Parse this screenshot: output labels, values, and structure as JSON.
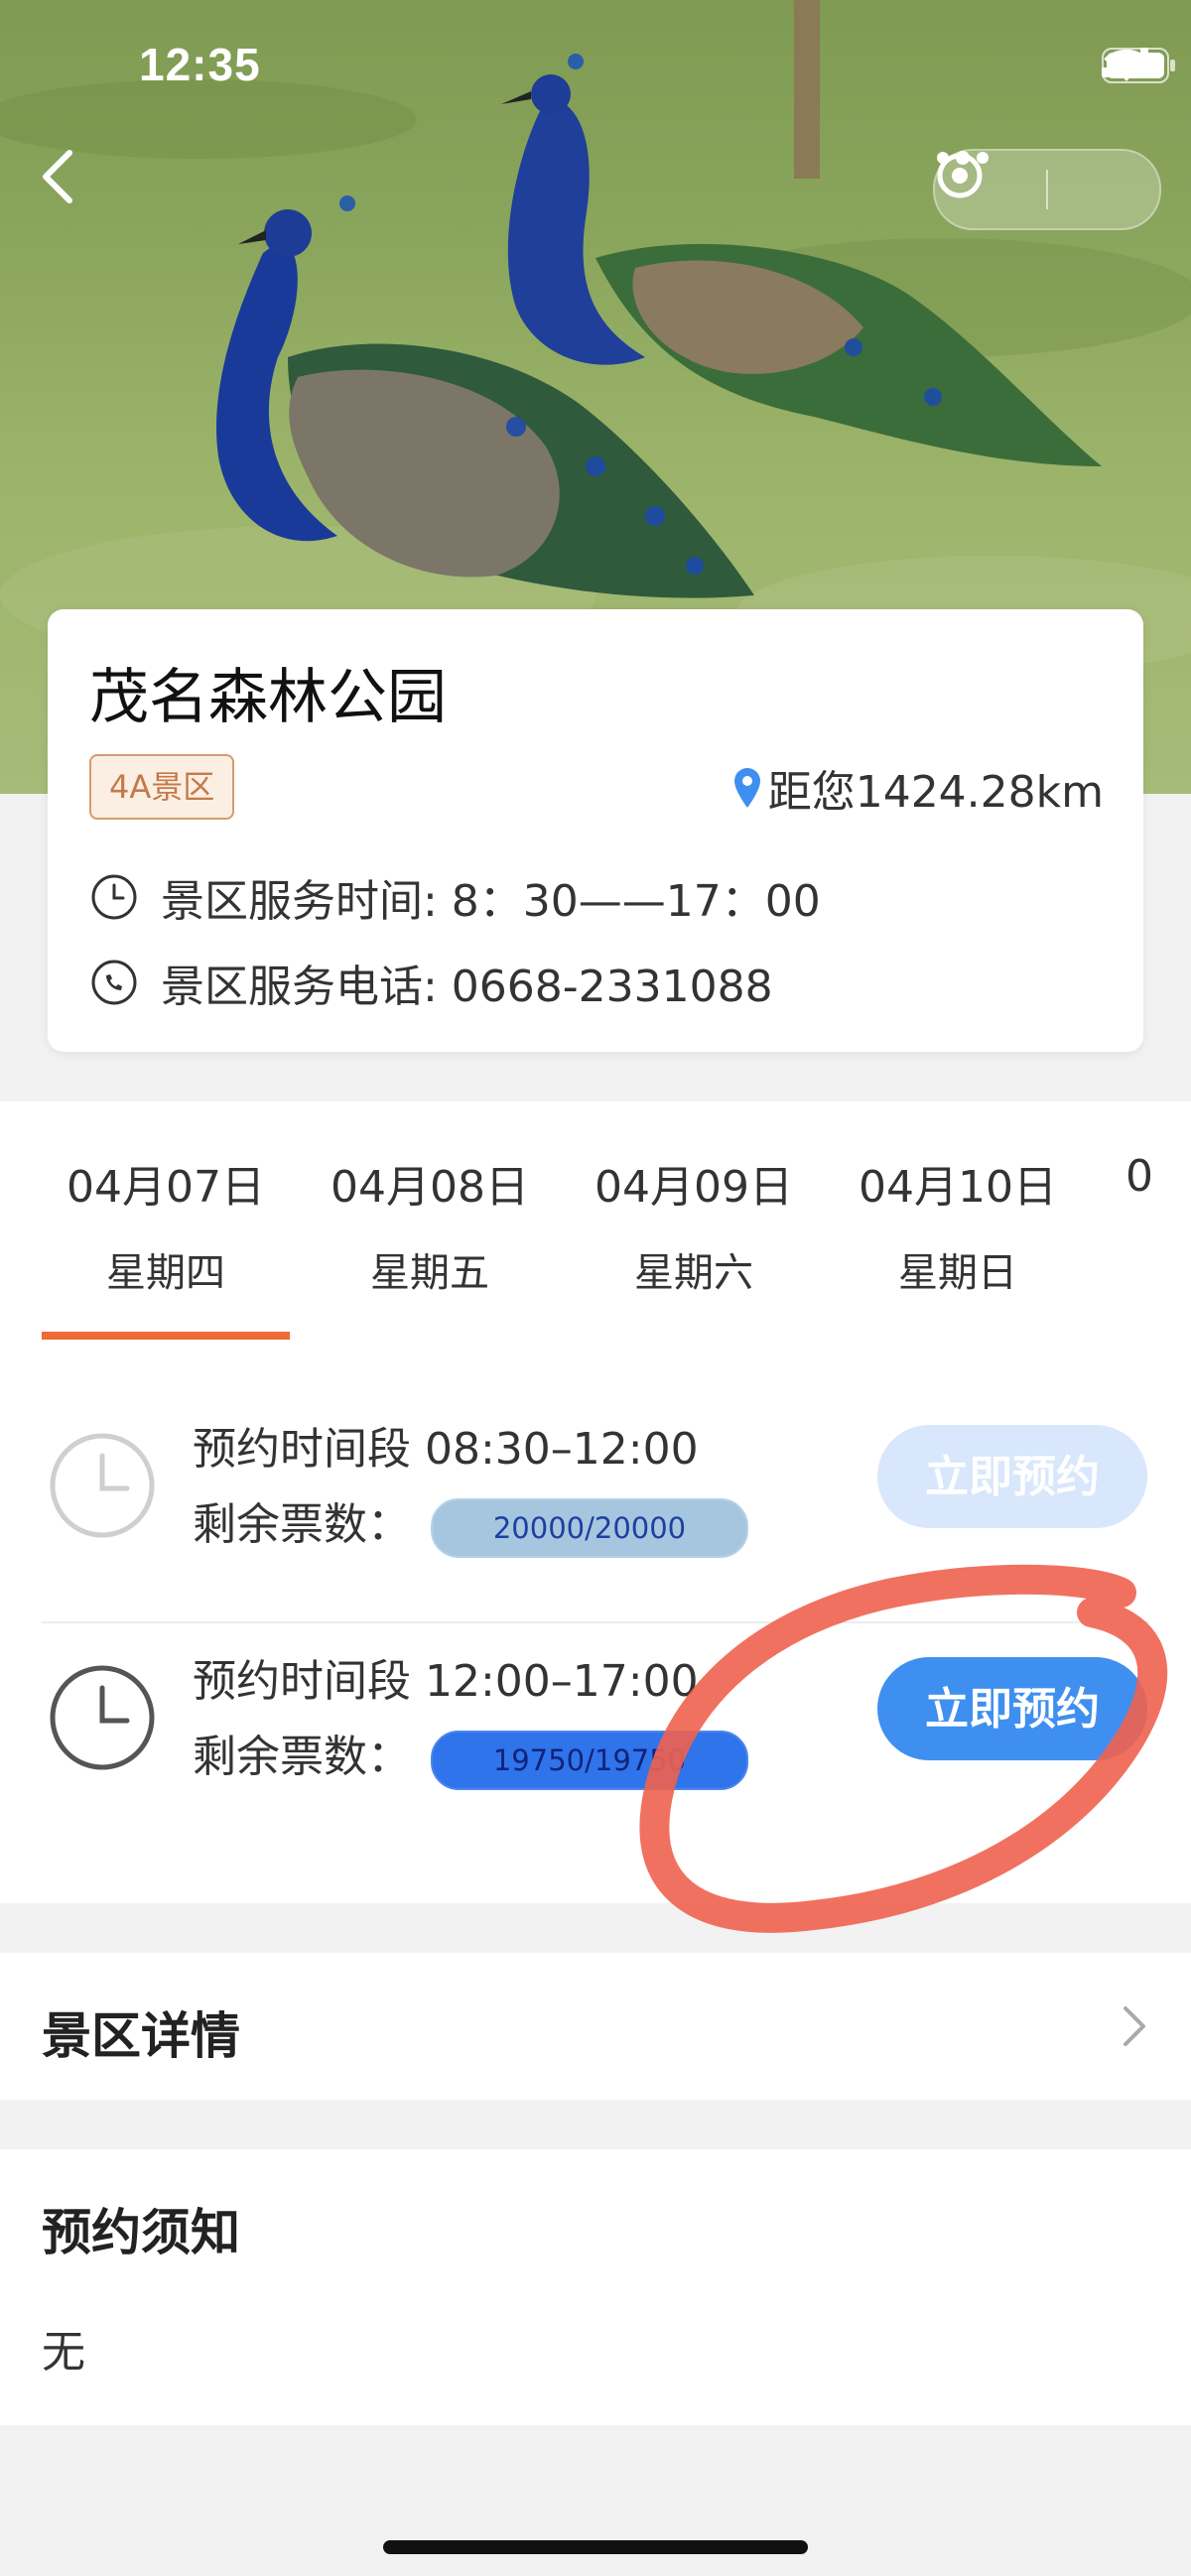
{
  "status_bar": {
    "time": "12:35"
  },
  "nav": {
    "back_icon": "chevron-left-icon",
    "more_icon": "more-dots-icon",
    "close_icon": "target-circle-icon"
  },
  "park": {
    "name": "茂名森林公园",
    "level_badge": "4A景区",
    "distance": "距您1424.28km",
    "service_time": "景区服务时间: 8：30——17：00",
    "service_phone": "景区服务电话: 0668-2331088"
  },
  "date_tabs": [
    {
      "date": "04月07日",
      "weekday": "星期四",
      "selected": true
    },
    {
      "date": "04月08日",
      "weekday": "星期五",
      "selected": false
    },
    {
      "date": "04月09日",
      "weekday": "星期六",
      "selected": false
    },
    {
      "date": "04月10日",
      "weekday": "星期日",
      "selected": false
    },
    {
      "date": "0",
      "weekday": "",
      "selected": false
    }
  ],
  "slots": [
    {
      "time_range": "预约时间段 08:30–12:00",
      "remaining_label": "剩余票数：",
      "remaining": "20000/20000",
      "button": "立即预约",
      "enabled": false
    },
    {
      "time_range": "预约时间段 12:00–17:00",
      "remaining_label": "剩余票数：",
      "remaining": "19750/19750",
      "button": "立即预约",
      "enabled": true
    }
  ],
  "sections": {
    "detail_title": "景区详情",
    "notice_title": "预约须知",
    "notice_body": "无"
  },
  "colors": {
    "accent_orange": "#f06a35",
    "button_blue": "#3f8ff0",
    "button_disabled": "#d8e7fb",
    "annotation_red": "#f0624f"
  }
}
